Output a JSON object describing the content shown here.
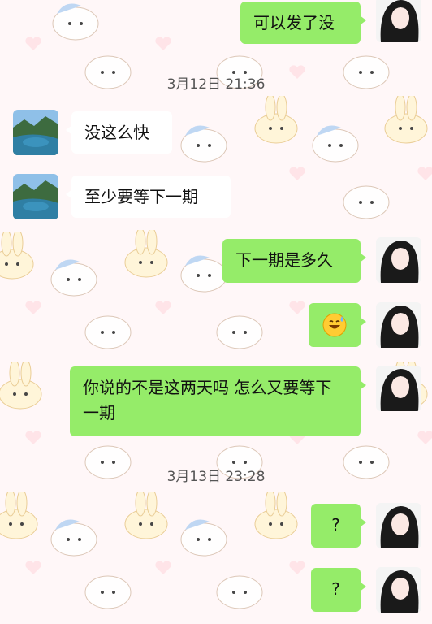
{
  "messages": [
    {
      "side": "me",
      "text": "可以发了没"
    },
    {
      "type": "time",
      "text": "3月12日 21:36"
    },
    {
      "side": "them",
      "text": "没这么快"
    },
    {
      "side": "them",
      "text": "至少要等下一期"
    },
    {
      "side": "me",
      "text": "下一期是多久"
    },
    {
      "side": "me",
      "emoji": "sweat-smile-emoji"
    },
    {
      "side": "me",
      "text": "你说的不是这两天吗 怎么又要等下一期"
    },
    {
      "type": "time",
      "text": "3月13日 23:28"
    },
    {
      "side": "me",
      "text": "?"
    },
    {
      "side": "me",
      "text": "?"
    }
  ],
  "colors": {
    "my_bubble": "#95ec69",
    "their_bubble": "#ffffff",
    "background": "#fff7f8"
  }
}
